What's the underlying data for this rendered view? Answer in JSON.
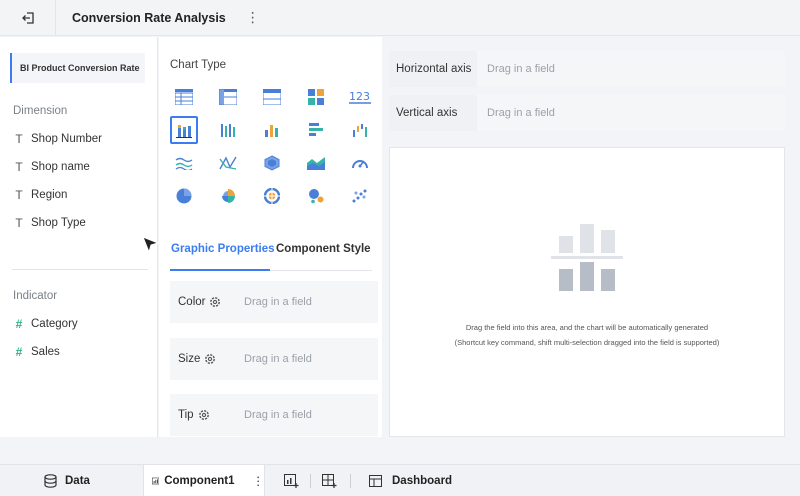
{
  "header": {
    "title": "Conversion Rate Analysis",
    "more": "⋮"
  },
  "left": {
    "dataset": "BI Product Conversion Rate",
    "dimension_title": "Dimension",
    "dimensions": [
      "Shop Number",
      "Shop name",
      "Region",
      "Shop Type"
    ],
    "indicator_title": "Indicator",
    "indicators": [
      "Category",
      "Sales"
    ]
  },
  "middle": {
    "chart_type_title": "Chart Type",
    "tabs": {
      "graphic": "Graphic Properties",
      "component": "Component Style"
    },
    "properties": [
      {
        "label": "Color",
        "placeholder": "Drag in a field"
      },
      {
        "label": "Size",
        "placeholder": "Drag in a field"
      },
      {
        "label": "Tip",
        "placeholder": "Drag in a field"
      }
    ]
  },
  "right": {
    "horizontal_axis": {
      "label": "Horizontal axis",
      "placeholder": "Drag in a field"
    },
    "vertical_axis": {
      "label": "Vertical axis",
      "placeholder": "Drag in a field"
    },
    "message1": "Drag the field into this area, and the chart will be automatically generated",
    "message2": "(Shortcut key command, shift multi-selection dragged into the field is supported)"
  },
  "bottom": {
    "data": "Data",
    "component": "Component1",
    "more": "⋮",
    "dashboard": "Dashboard"
  },
  "colors": {
    "accent": "#3b7df0",
    "indicator": "#2cb28b",
    "icon_blue": "#4a7fd8",
    "icon_teal": "#35b3a8",
    "icon_orange": "#f0a23a"
  }
}
